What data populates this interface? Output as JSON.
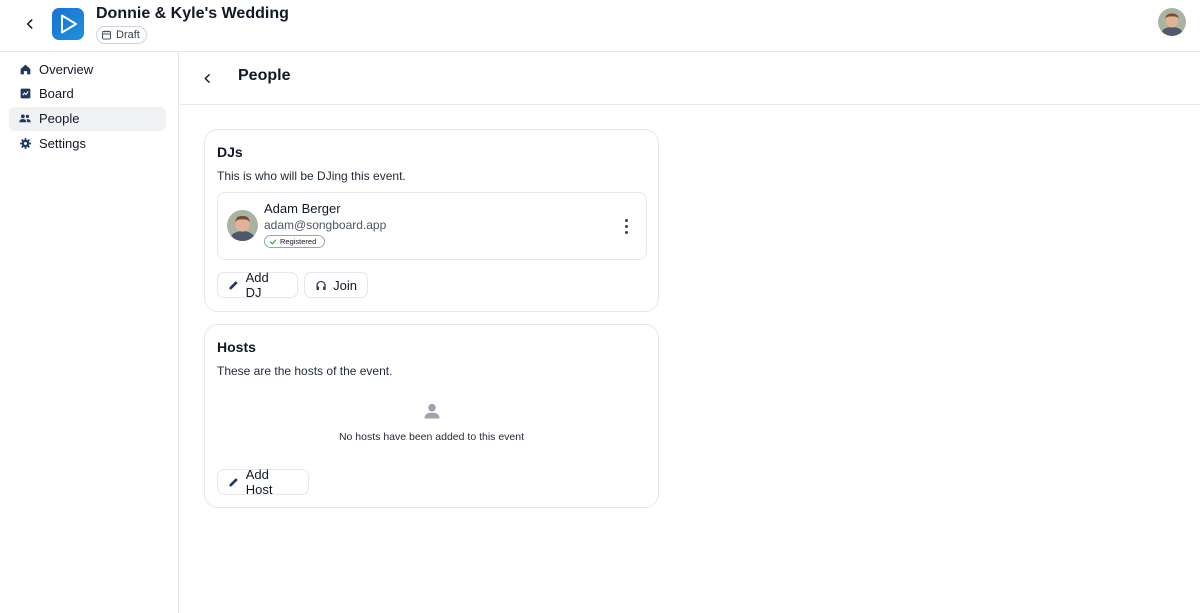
{
  "header": {
    "event_title": "Donnie & Kyle's Wedding",
    "status_chip": "Draft",
    "back_icon": "chevron-left-icon",
    "logo_icon": "play-logo-icon",
    "avatar_icon": "user-avatar-photo"
  },
  "sidebar": {
    "items": [
      {
        "label": "Overview",
        "icon": "home-icon",
        "active": false
      },
      {
        "label": "Board",
        "icon": "board-icon",
        "active": false
      },
      {
        "label": "People",
        "icon": "people-icon",
        "active": true
      },
      {
        "label": "Settings",
        "icon": "gear-icon",
        "active": false
      }
    ]
  },
  "page": {
    "title": "People",
    "back_icon": "chevron-left-icon"
  },
  "djs": {
    "title": "DJs",
    "subtitle": "This is who will be DJing this event.",
    "people": [
      {
        "name": "Adam Berger",
        "email": "adam@songboard.app",
        "badge": "Registered"
      }
    ],
    "add_label": "Add DJ",
    "join_label": "Join"
  },
  "hosts": {
    "title": "Hosts",
    "subtitle": "These are the hosts of the event.",
    "empty_text": "No hosts have been added to this event",
    "add_label": "Add Host"
  },
  "colors": {
    "accent": "#1e6fd9",
    "nav_icon": "#1e3a5f",
    "active_bg": "#f0f1f3",
    "border": "#e5e7eb"
  }
}
